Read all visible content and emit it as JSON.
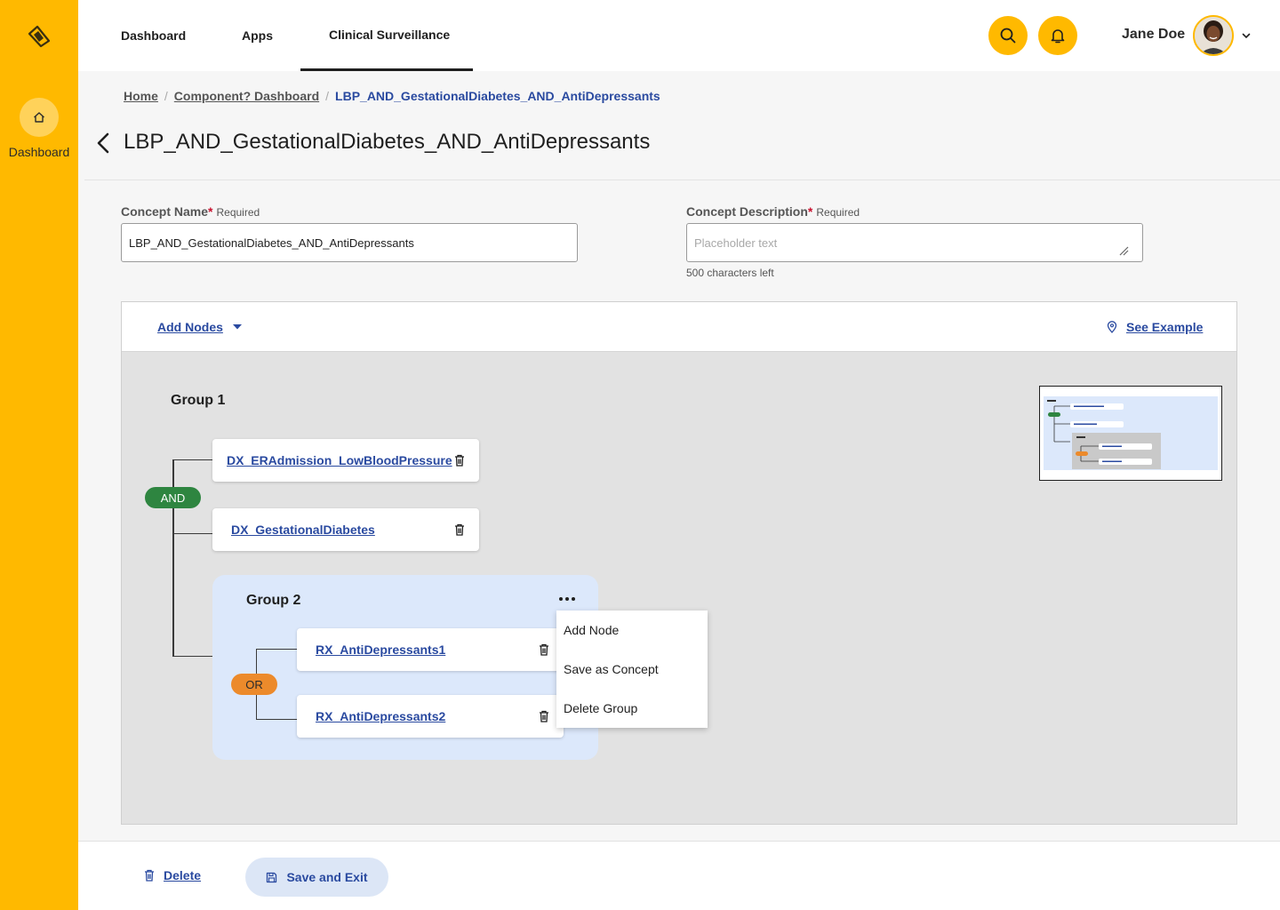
{
  "sidebar": {
    "home_label": "Dashboard"
  },
  "topnav": {
    "tabs": [
      {
        "label": "Dashboard"
      },
      {
        "label": "Apps"
      },
      {
        "label": "Clinical Surveillance",
        "active": true
      }
    ],
    "user_name": "Jane Doe"
  },
  "breadcrumb": {
    "items": [
      "Home",
      "Component? Dashboard",
      "LBP_AND_GestationalDiabetes_AND_AntiDepressants"
    ]
  },
  "page": {
    "title": "LBP_AND_GestationalDiabetes_AND_AntiDepressants"
  },
  "form": {
    "concept_name": {
      "label": "Concept Name",
      "required_marker": "*",
      "required_text": "Required",
      "value": "LBP_AND_GestationalDiabetes_AND_AntiDepressants"
    },
    "concept_description": {
      "label": "Concept Description",
      "required_marker": "*",
      "required_text": "Required",
      "placeholder": "Placeholder text",
      "chars_left": "500 characters left"
    }
  },
  "canvas": {
    "add_nodes_label": "Add Nodes",
    "see_example_label": "See Example",
    "group1": {
      "title": "Group 1",
      "operator": "AND",
      "nodes": [
        "DX_ERAdmission_LowBloodPressure",
        "DX_GestationalDiabetes"
      ]
    },
    "group2": {
      "title": "Group 2",
      "operator": "OR",
      "nodes": [
        "RX_AntiDepressants1",
        "RX_AntiDepressants2"
      ]
    },
    "group_menu": [
      "Add Node",
      "Save as Concept",
      "Delete Group"
    ]
  },
  "footer": {
    "delete_label": "Delete",
    "save_exit_label": "Save and Exit"
  },
  "colors": {
    "brand": "#ffb900",
    "link": "#2a4aa0",
    "and_pill": "#2e8540",
    "or_pill": "#ec8a2b",
    "group_bg": "#dce8fb"
  }
}
